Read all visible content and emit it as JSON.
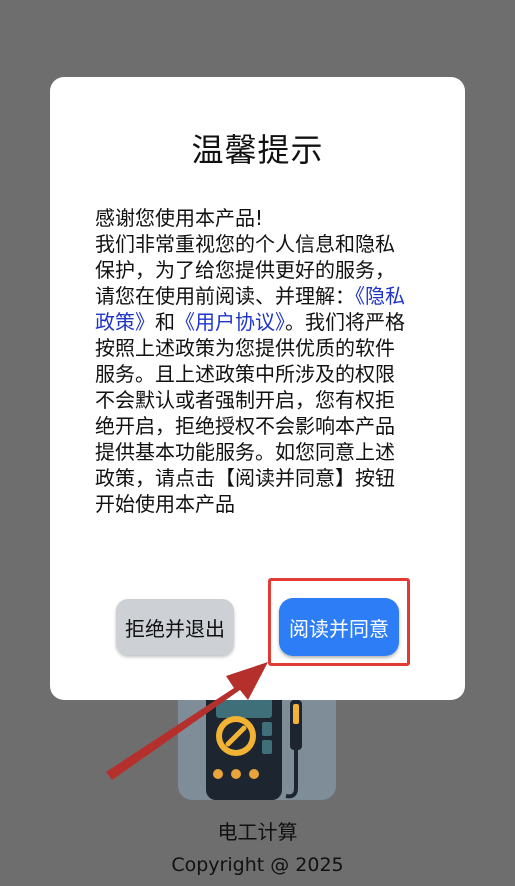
{
  "app": {
    "name": "电工计算",
    "copyright": "Copyright @ 2025",
    "icon": "multimeter-icon"
  },
  "dialog": {
    "title": "温馨提示",
    "body": {
      "intro": "感谢您使用本产品!",
      "part1": "我们非常重视您的个人信息和隐私保护，为了给您提供更好的服务，请您在使用前阅读、并理解：",
      "privacy_link": "《隐私政策》",
      "and": "和",
      "user_link": "《用户协议》",
      "part2": "。我们将严格按照上述政策为您提供优质的软件服务。且上述政策中所涉及的权限不会默认或者强制开启，您有权拒绝开启，拒绝授权不会影响本产品提供基本功能服务。如您同意上述政策，请点击【阅读并同意】按钮开始使用本产品"
    },
    "reject_label": "拒绝并退出",
    "accept_label": "阅读并同意"
  },
  "colors": {
    "overlay": "#6e6e6e",
    "accent": "#2d7df7",
    "link": "#1f35c9",
    "highlight": "#e43a36"
  }
}
